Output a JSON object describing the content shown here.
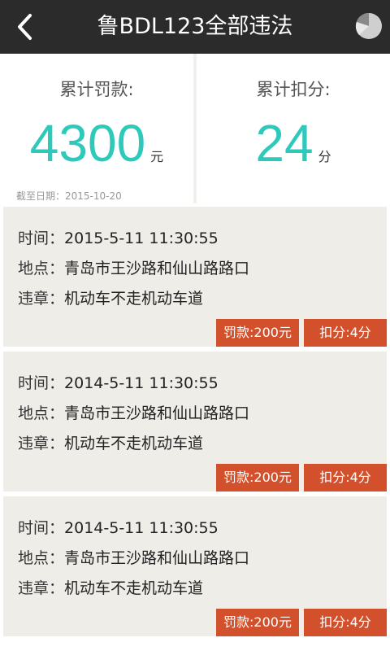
{
  "header": {
    "title": "鲁BDL123全部违法",
    "back_icon": "chevron-left-icon",
    "stats_icon": "pie-chart-icon"
  },
  "summary": {
    "fine_label": "累计罚款:",
    "fine_value": "4300",
    "fine_unit": "元",
    "points_label": "累计扣分:",
    "points_value": "24",
    "points_unit": "分",
    "as_of": "截至日期：2015-10-20"
  },
  "violations": [
    {
      "time_label": "时间：",
      "time": "2015-5-11 11:30:55",
      "place_label": "地点：",
      "place": "青岛市王沙路和仙山路路口",
      "offense_label": "违章：",
      "offense": "机动车不走机动车道",
      "fine": "罚款:200元",
      "points": "扣分:4分"
    },
    {
      "time_label": "时间：",
      "time": "2014-5-11 11:30:55",
      "place_label": "地点：",
      "place": "青岛市王沙路和仙山路路口",
      "offense_label": "违章：",
      "offense": "机动车不走机动车道",
      "fine": "罚款:200元",
      "points": "扣分:4分"
    },
    {
      "time_label": "时间：",
      "time": "2014-5-11 11:30:55",
      "place_label": "地点：",
      "place": "青岛市王沙路和仙山路路口",
      "offense_label": "违章：",
      "offense": "机动车不走机动车道",
      "fine": "罚款:200元",
      "points": "扣分:4分"
    }
  ],
  "colors": {
    "header_bg": "#2b2b2b",
    "accent_teal": "#2ec9bb",
    "badge_red": "#d2512c",
    "card_bg": "#efede8"
  }
}
